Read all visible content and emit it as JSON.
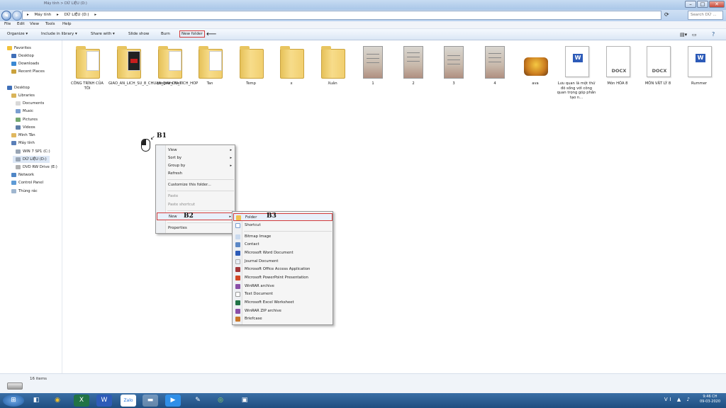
{
  "window": {
    "title": "Máy tính > DỮ LIỆU (D:)",
    "buttons": [
      "–",
      "□",
      "✕"
    ]
  },
  "address": {
    "crumbs": [
      "▸",
      "Máy tính",
      "▸",
      "DỮ LIỆU (D:)",
      "▸"
    ],
    "search_placeholder": "Search DỮ ..."
  },
  "menubar": [
    "File",
    "Edit",
    "View",
    "Tools",
    "Help"
  ],
  "toolbar": {
    "organize": "Organize ▾",
    "include": "Include in library ▾",
    "share": "Share with ▾",
    "slideshow": "Slide show",
    "burn": "Burn",
    "new_folder": "New folder",
    "arrow": "⟵"
  },
  "nav": {
    "favorites": "Favorites",
    "desktop": "Desktop",
    "downloads": "Downloads",
    "recent": "Recent Places",
    "desktop2": "Desktop",
    "libraries": "Libraries",
    "documents": "Documents",
    "music": "Music",
    "pictures": "Pictures",
    "videos": "Videos",
    "user": "Minh Tân",
    "computer": "Máy tính",
    "c_drive": "WIN 7 SP1 (C:)",
    "d_drive": "DỮ LIỆU (D:)",
    "e_drive": "DVD RW Drive (E:)",
    "network": "Network",
    "control": "Control Panel",
    "trash": "Thùng rác"
  },
  "files": [
    {
      "label": "CÔNG TRÌNH CỦA TÔI",
      "kind": "folder"
    },
    {
      "label": "GIAO_AN_LICH_SU_8_CHUAN_DAY_DU_TICH_HOP",
      "kind": "folder-red"
    },
    {
      "label": "program files",
      "kind": "folder"
    },
    {
      "label": "Tan",
      "kind": "folder"
    },
    {
      "label": "Temp",
      "kind": "folder"
    },
    {
      "label": "x",
      "kind": "folder"
    },
    {
      "label": "Xuân",
      "kind": "folder"
    },
    {
      "label": "1",
      "kind": "photo"
    },
    {
      "label": "2",
      "kind": "photo"
    },
    {
      "label": "3",
      "kind": "photo"
    },
    {
      "label": "4",
      "kind": "photo"
    },
    {
      "label": "ava",
      "kind": "image"
    },
    {
      "label": "Lưu quan là một thứ đô sống với công quan trọng góp phần tạo n...",
      "kind": "word"
    },
    {
      "label": "Môn HÓA 8",
      "kind": "docx",
      "badge": "DOCX"
    },
    {
      "label": "MÔN VẬT LÝ 8",
      "kind": "docx",
      "badge": "DOCX"
    },
    {
      "label": "Rummer",
      "kind": "word"
    }
  ],
  "context_menu": {
    "view": "View",
    "sort": "Sort by",
    "group": "Group by",
    "refresh": "Refresh",
    "customize": "Customize this folder...",
    "paste": "Paste",
    "paste_shortcut": "Paste shortcut",
    "new": "New",
    "properties": "Properties",
    "arrow": "▸"
  },
  "new_menu": {
    "folder": "Folder",
    "shortcut": "Shortcut",
    "bitmap": "Bitmap Image",
    "contact": "Contact",
    "word": "Microsoft Word Document",
    "journal": "Journal Document",
    "access": "Microsoft Office Access Application",
    "ppt": "Microsoft PowerPoint Presentation",
    "winrar": "WinRAR archive",
    "text": "Text Document",
    "excel": "Microsoft Excel Worksheet",
    "zip": "WinRAR ZIP archive",
    "briefcase": "Briefcase"
  },
  "annotations": {
    "b1": "B1",
    "b2": "B2",
    "b3": "B3"
  },
  "status": {
    "count": "16 items"
  },
  "taskbar": {
    "time": "9:46 CH",
    "date": "09-03-2020",
    "tray": "VI ▲ ♪"
  },
  "colors": {
    "highlight": "#d23b3b",
    "taskbar": "#2b5d93"
  }
}
